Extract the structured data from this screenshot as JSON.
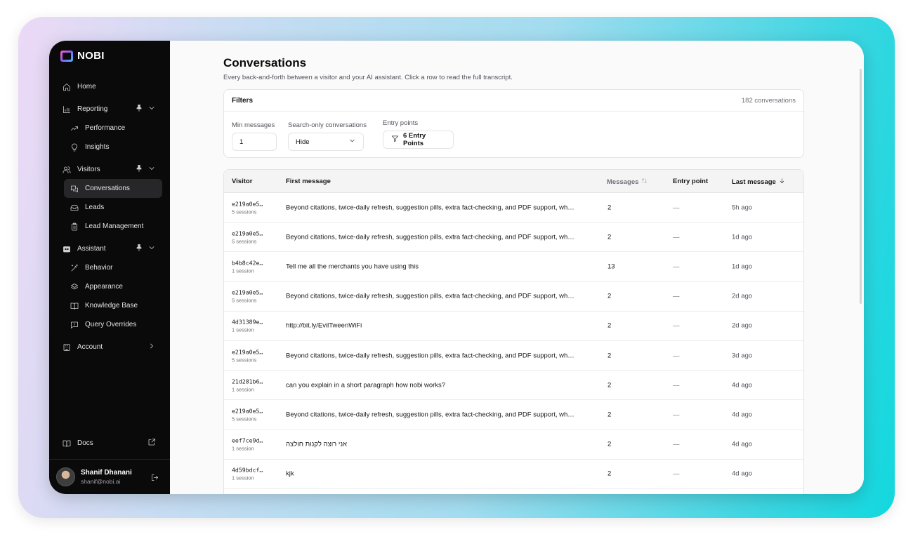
{
  "brand": {
    "name": "NOBI"
  },
  "nav": {
    "home": "Home",
    "reporting": "Reporting",
    "performance": "Performance",
    "insights": "Insights",
    "visitors": "Visitors",
    "conversations": "Conversations",
    "leads": "Leads",
    "lead_management": "Lead Management",
    "assistant": "Assistant",
    "behavior": "Behavior",
    "appearance": "Appearance",
    "knowledge_base": "Knowledge Base",
    "query_overrides": "Query Overrides",
    "account": "Account",
    "docs": "Docs"
  },
  "user": {
    "name": "Shanif Dhanani",
    "email": "shanif@nobi.ai"
  },
  "page": {
    "title": "Conversations",
    "subtitle": "Every back-and-forth between a visitor and your AI assistant. Click a row to read the full transcript."
  },
  "filters": {
    "title": "Filters",
    "count": "182 conversations",
    "min_messages_label": "Min messages",
    "min_messages_value": "1",
    "search_only_label": "Search-only conversations",
    "search_only_value": "Hide",
    "entry_points_label": "Entry points",
    "entry_points_button": "6 Entry Points"
  },
  "table": {
    "headers": {
      "visitor": "Visitor",
      "first_message": "First message",
      "messages": "Messages",
      "entry_point": "Entry point",
      "last_message": "Last message"
    },
    "rows": [
      {
        "visitor": "e219a0e5…",
        "sessions": "5 sessions",
        "first": "Beyond citations, twice-daily refresh, suggestion pills, extra fact-checking, and PDF support, wh…",
        "messages": "2",
        "entry": "—",
        "last": "5h ago"
      },
      {
        "visitor": "e219a0e5…",
        "sessions": "5 sessions",
        "first": "Beyond citations, twice-daily refresh, suggestion pills, extra fact-checking, and PDF support, wh…",
        "messages": "2",
        "entry": "—",
        "last": "1d ago"
      },
      {
        "visitor": "b4b8c42e…",
        "sessions": "1 session",
        "first": "Tell me all the merchants you have using this",
        "messages": "13",
        "entry": "—",
        "last": "1d ago"
      },
      {
        "visitor": "e219a0e5…",
        "sessions": "5 sessions",
        "first": "Beyond citations, twice-daily refresh, suggestion pills, extra fact-checking, and PDF support, wh…",
        "messages": "2",
        "entry": "—",
        "last": "2d ago"
      },
      {
        "visitor": "4d31389e…",
        "sessions": "1 session",
        "first": "http://bit.ly/EvilTweenWiFi",
        "messages": "2",
        "entry": "—",
        "last": "2d ago"
      },
      {
        "visitor": "e219a0e5…",
        "sessions": "5 sessions",
        "first": "Beyond citations, twice-daily refresh, suggestion pills, extra fact-checking, and PDF support, wh…",
        "messages": "2",
        "entry": "—",
        "last": "3d ago"
      },
      {
        "visitor": "21d281b6…",
        "sessions": "1 session",
        "first": "can you explain in a short paragraph how nobi works?",
        "messages": "2",
        "entry": "—",
        "last": "4d ago"
      },
      {
        "visitor": "e219a0e5…",
        "sessions": "5 sessions",
        "first": "Beyond citations, twice-daily refresh, suggestion pills, extra fact-checking, and PDF support, wh…",
        "messages": "2",
        "entry": "—",
        "last": "4d ago"
      },
      {
        "visitor": "eef7ce9d…",
        "sessions": "1 session",
        "first": "אני רוצה לקנות חולצה",
        "messages": "2",
        "entry": "—",
        "last": "4d ago"
      },
      {
        "visitor": "4d59bdcf…",
        "sessions": "1 session",
        "first": "kjk",
        "messages": "2",
        "entry": "—",
        "last": "4d ago"
      }
    ]
  }
}
